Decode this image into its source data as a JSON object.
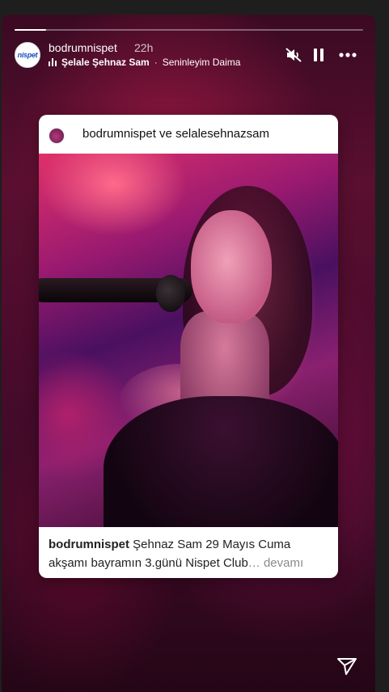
{
  "story": {
    "progress": 0.09,
    "username": "bodrumnispet",
    "time": "22h",
    "avatar_text": "nispet",
    "music": {
      "artist": "Şelale Şehnaz Sam",
      "separator": "·",
      "song": "Seninleyim Daima"
    }
  },
  "icons": {
    "mute": "speaker-muted-icon",
    "pause": "pause-icon",
    "more": "more-horizontal-icon",
    "share": "paper-plane-icon"
  },
  "post": {
    "title": "bodrumnispet ve selalesehnazsam",
    "caption_user": "bodrumnispet",
    "caption_text": " Şehnaz Sam 29 Mayıs Cuma akşamı bayramın 3.günü Nispet Club",
    "caption_more": "… devamı"
  }
}
